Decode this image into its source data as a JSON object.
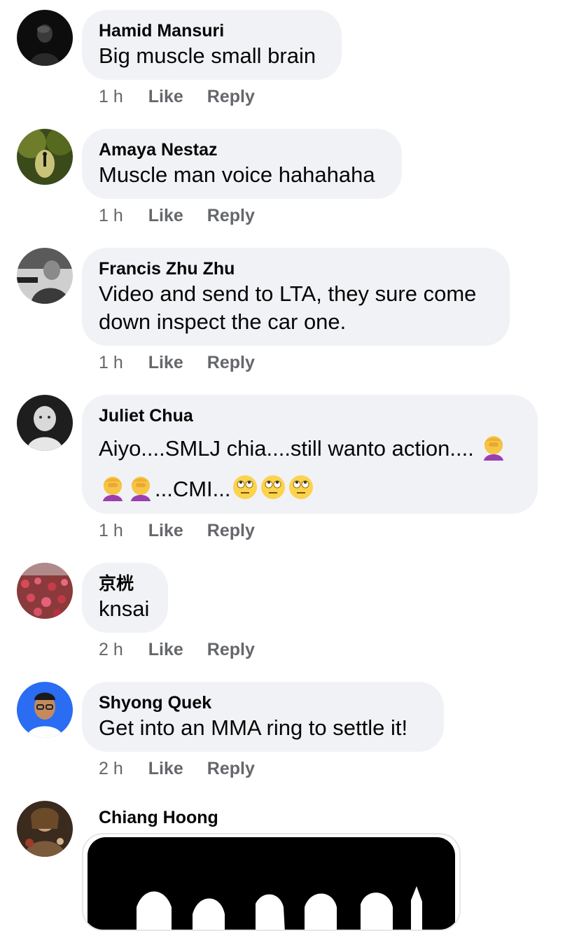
{
  "comments": [
    {
      "author": "Hamid Mansuri",
      "text": "Big muscle small brain",
      "time": "1 h",
      "like": "Like",
      "reply": "Reply"
    },
    {
      "author": "Amaya Nestaz",
      "text": "Muscle man voice hahahaha",
      "time": "1 h",
      "like": "Like",
      "reply": "Reply"
    },
    {
      "author": "Francis Zhu Zhu",
      "text_line1": "Video and send to LTA, they sure come",
      "text_line2": "down inspect the car one.",
      "time": "1 h",
      "like": "Like",
      "reply": "Reply"
    },
    {
      "author": "Juliet Chua",
      "text_line1": "Aiyo....SMLJ chia....still wanto action....",
      "text_line2_mid": "...CMI...",
      "time": "1 h",
      "like": "Like",
      "reply": "Reply",
      "emojis": [
        "woman-facepalming",
        "face-with-rolling-eyes"
      ]
    },
    {
      "author": "京桄",
      "text": "knsai",
      "time": "2 h",
      "like": "Like",
      "reply": "Reply"
    },
    {
      "author": "Shyong Quek",
      "text": "Get into an MMA ring to settle it!",
      "time": "2 h",
      "like": "Like",
      "reply": "Reply"
    },
    {
      "author": "Chiang Hoong",
      "attachment": "image"
    }
  ],
  "colors": {
    "bubble": "#f0f2f5",
    "meta": "#65676b",
    "text": "#050505"
  }
}
